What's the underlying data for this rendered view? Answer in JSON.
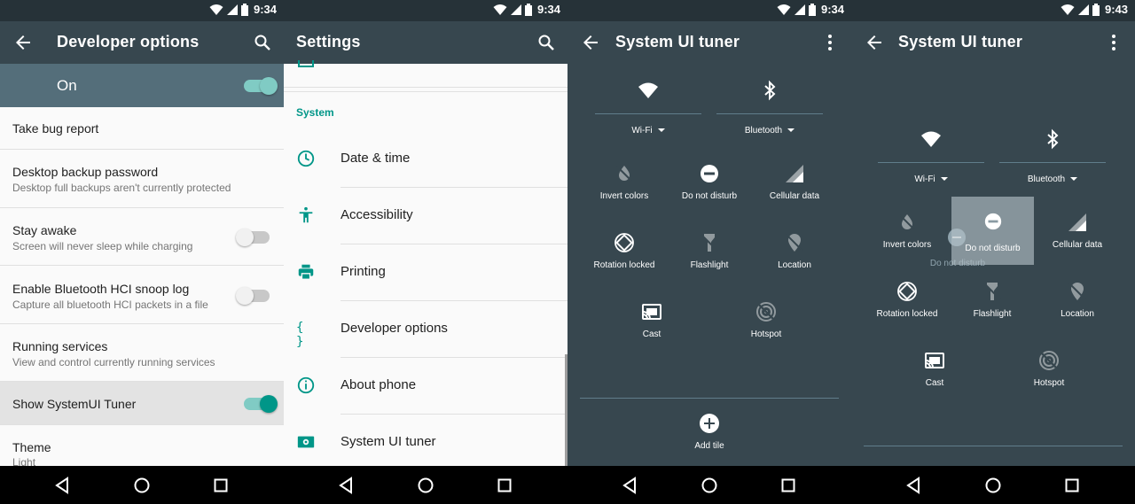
{
  "status": {
    "time_p1": "9:34",
    "time_p2": "9:34",
    "time_p3": "9:34",
    "time_p4": "9:43"
  },
  "dev": {
    "title": "Developer options",
    "master_label": "On",
    "rows": [
      {
        "title": "Take bug report"
      },
      {
        "title": "Desktop backup password",
        "subtitle": "Desktop full backups aren't currently protected"
      },
      {
        "title": "Stay awake",
        "subtitle": "Screen will never sleep while charging"
      },
      {
        "title": "Enable Bluetooth HCI snoop log",
        "subtitle": "Capture all bluetooth HCI packets in a file"
      },
      {
        "title": "Running services",
        "subtitle": "View and control currently running services"
      },
      {
        "title": "Show SystemUI Tuner"
      },
      {
        "title": "Theme",
        "subtitle": "Light"
      }
    ]
  },
  "settings": {
    "title": "Settings",
    "section": "System",
    "items": [
      {
        "label": "Date & time",
        "icon": "clock-icon"
      },
      {
        "label": "Accessibility",
        "icon": "accessibility-icon"
      },
      {
        "label": "Printing",
        "icon": "printer-icon"
      },
      {
        "label": "Developer options",
        "icon": "braces-icon",
        "glyph": "{ }"
      },
      {
        "label": "About phone",
        "icon": "info-icon"
      },
      {
        "label": "System UI tuner",
        "icon": "tuner-icon"
      }
    ]
  },
  "tuner": {
    "title": "System UI tuner",
    "wifi": "Wi-Fi",
    "bluetooth": "Bluetooth",
    "tiles": {
      "invert": "Invert colors",
      "dnd": "Do not disturb",
      "cellular": "Cellular data",
      "rotation": "Rotation locked",
      "flashlight": "Flashlight",
      "location": "Location",
      "cast": "Cast",
      "hotspot": "Hotspot"
    },
    "add_tile": "Add tile",
    "drag_label": "Do not disturb"
  },
  "colors": {
    "accent": "#009688",
    "toolbar": "#37474f",
    "statusbar": "#263238"
  }
}
